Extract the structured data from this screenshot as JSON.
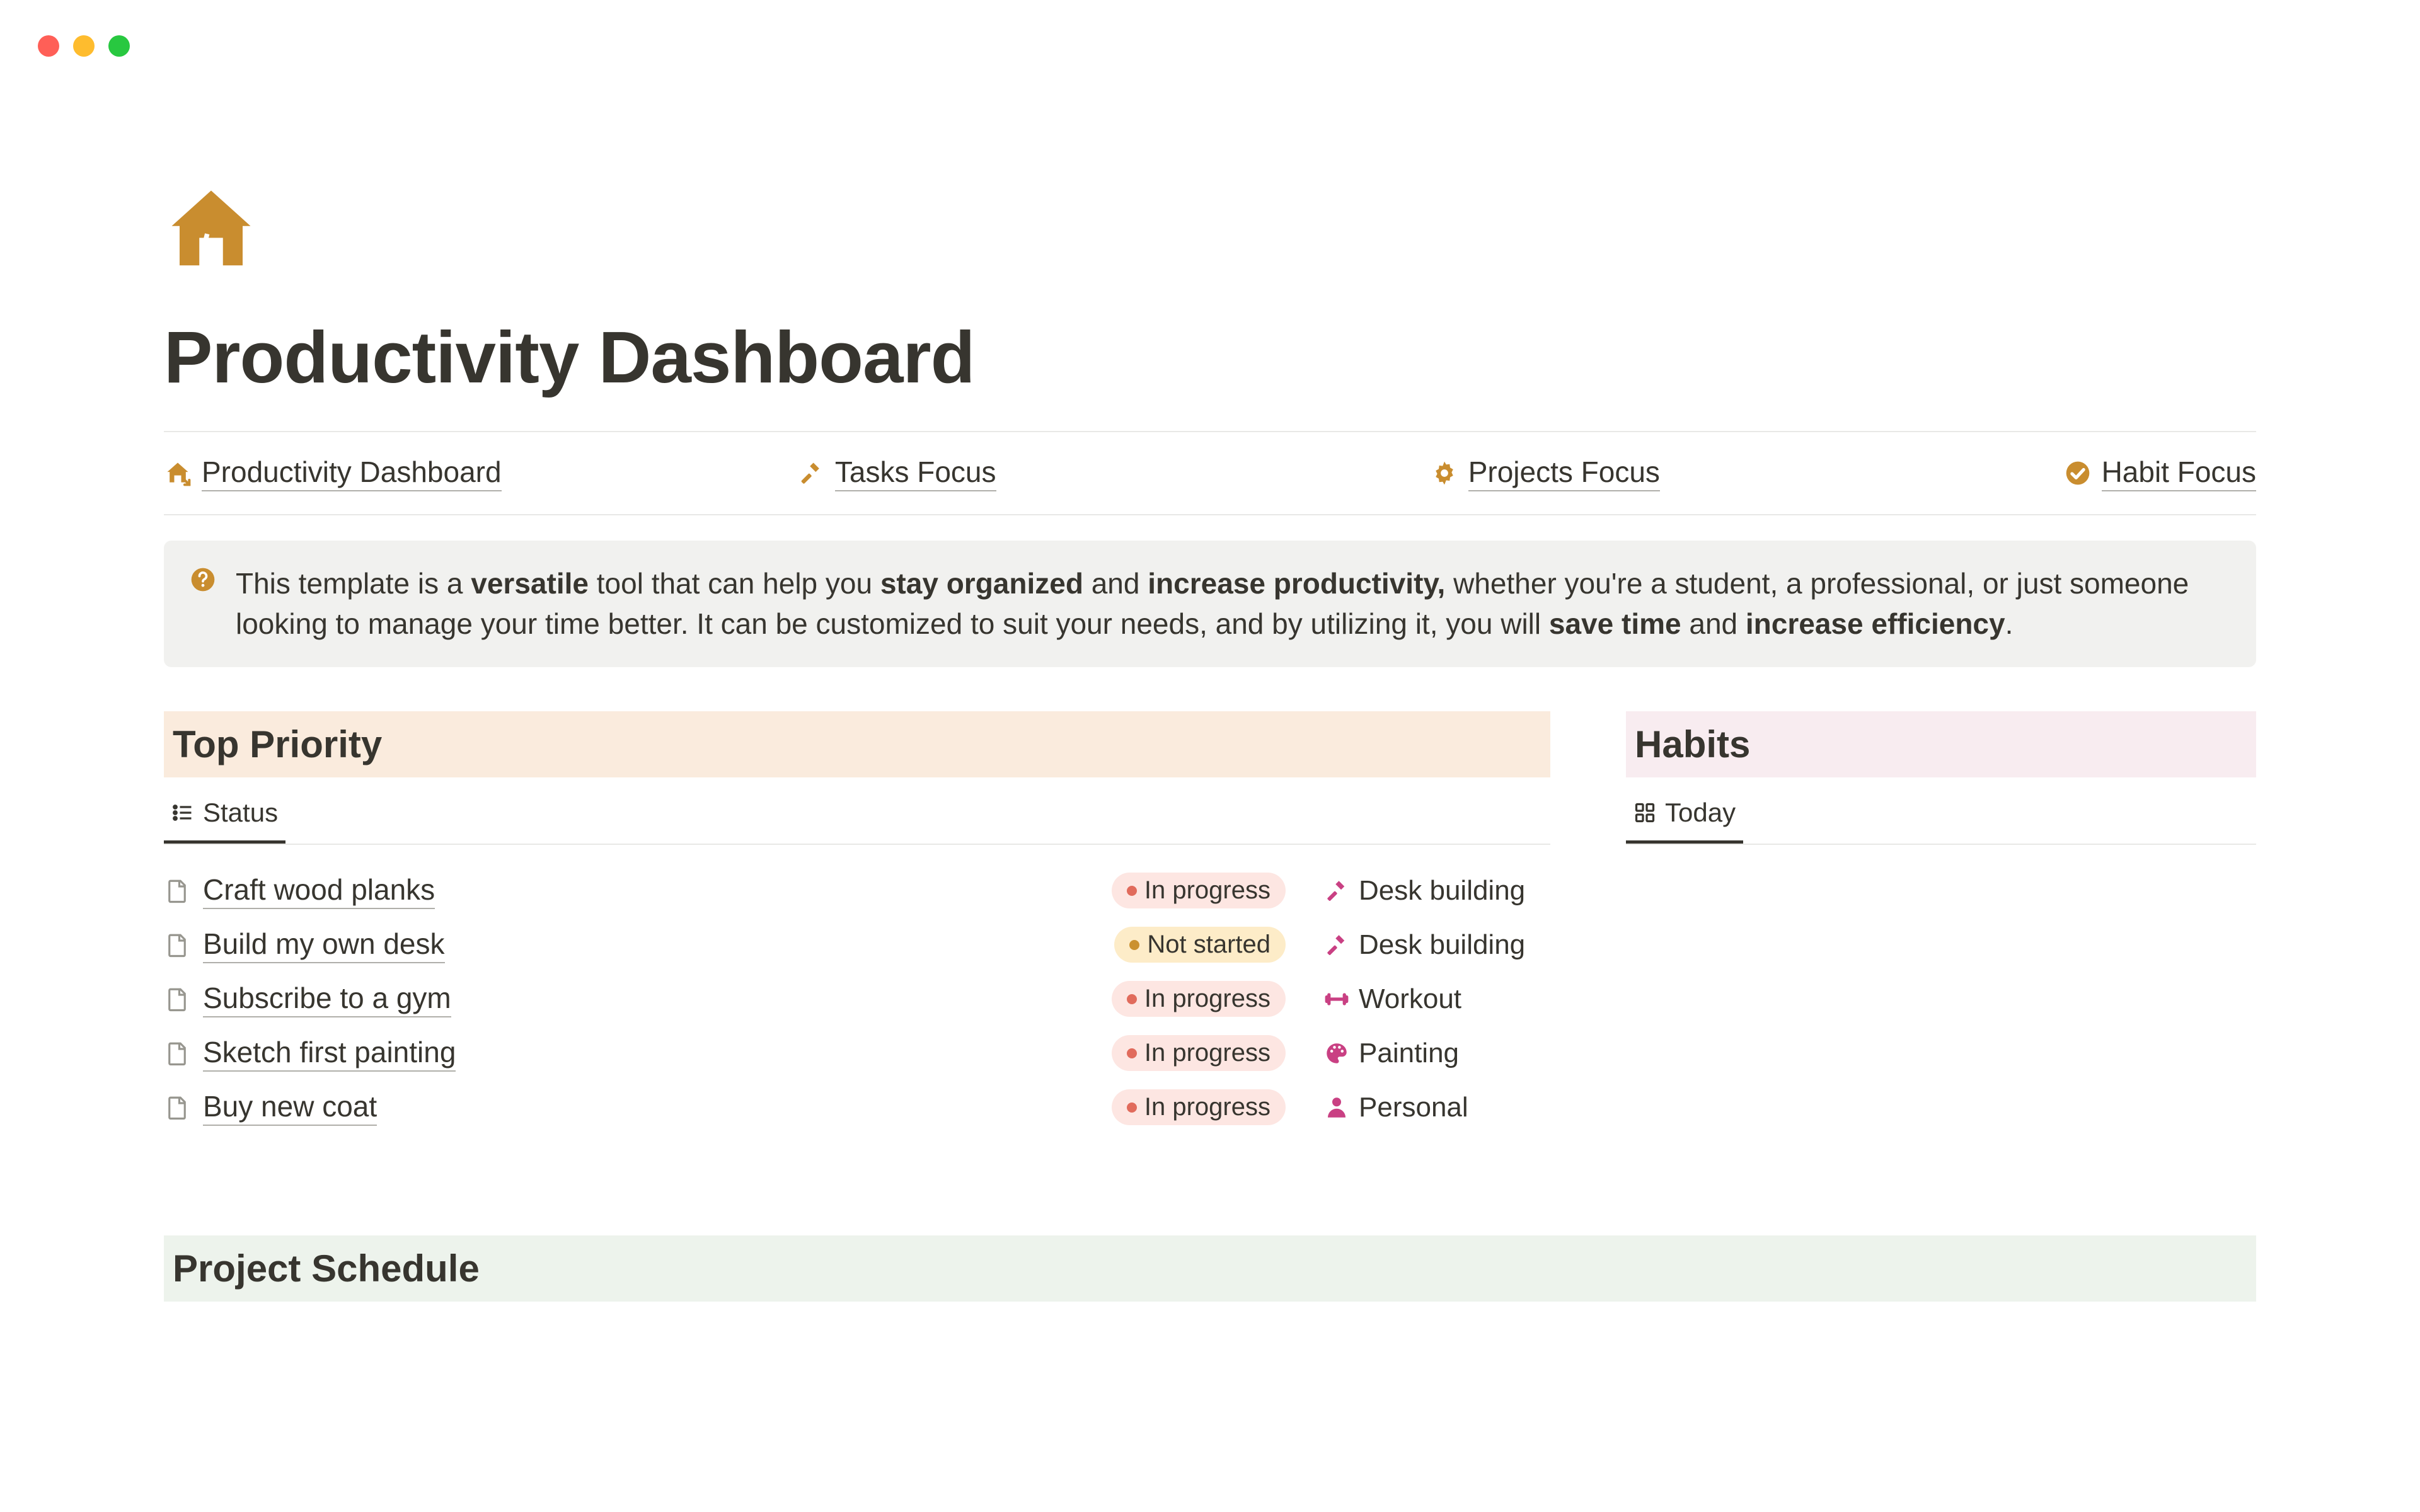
{
  "page": {
    "title": "Productivity Dashboard"
  },
  "nav": {
    "items": [
      {
        "label": "Productivity Dashboard",
        "icon": "house-arrow"
      },
      {
        "label": "Tasks Focus",
        "icon": "hammer"
      },
      {
        "label": "Projects Focus",
        "icon": "gear"
      },
      {
        "label": "Habit Focus",
        "icon": "check-circle"
      }
    ]
  },
  "callout": {
    "prefix": "This template is a ",
    "b1": "versatile",
    "mid1": " tool that can help you ",
    "b2": "stay organized",
    "mid2": " and ",
    "b3": "increase productivity,",
    "mid3": " whether you're a student, a professional, or just someone looking to manage your time better. It can be customized to suit your needs, and by utilizing it, you will ",
    "b4": "save time",
    "mid4": " and ",
    "b5": "increase efficiency",
    "suffix": "."
  },
  "sections": {
    "top_priority": {
      "title": "Top Priority",
      "tab": "Status"
    },
    "habits": {
      "title": "Habits",
      "tab": "Today"
    },
    "project_schedule": {
      "title": "Project Schedule"
    }
  },
  "tasks": [
    {
      "title": "Craft wood planks",
      "status": "In progress",
      "status_kind": "inprogress",
      "project": "Desk building",
      "project_icon": "hammer-pink"
    },
    {
      "title": "Build my own desk",
      "status": "Not started",
      "status_kind": "notstarted",
      "project": "Desk building",
      "project_icon": "hammer-pink"
    },
    {
      "title": "Subscribe to a gym",
      "status": "In progress",
      "status_kind": "inprogress",
      "project": "Workout",
      "project_icon": "dumbbell"
    },
    {
      "title": "Sketch first painting",
      "status": "In progress",
      "status_kind": "inprogress",
      "project": "Painting",
      "project_icon": "palette"
    },
    {
      "title": "Buy new coat",
      "status": "In progress",
      "status_kind": "inprogress",
      "project": "Personal",
      "project_icon": "person"
    }
  ],
  "colors": {
    "amber": "#c98d2f",
    "pink": "#c94083",
    "section_orange": "#faebdd",
    "section_pink": "#f8ecf0",
    "section_green": "#edf3ec"
  }
}
